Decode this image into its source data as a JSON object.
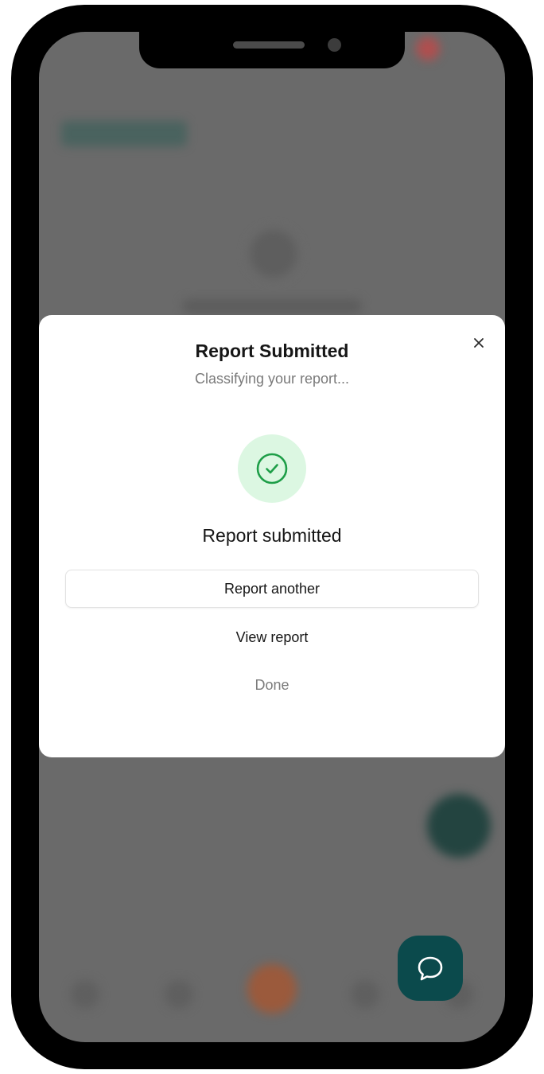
{
  "modal": {
    "title": "Report Submitted",
    "subtitle": "Classifying your report...",
    "status_heading": "Report submitted",
    "buttons": {
      "report_another": "Report another",
      "view_report": "View report",
      "done": "Done"
    }
  },
  "icons": {
    "close": "close-icon",
    "success": "check-circle-icon",
    "chat": "chat-bubble-icon"
  },
  "colors": {
    "success_green": "#1e9e48",
    "success_bg": "#dcf7e2",
    "chat_fab": "#0b4a4c",
    "overlay": "#6a6a6a"
  }
}
